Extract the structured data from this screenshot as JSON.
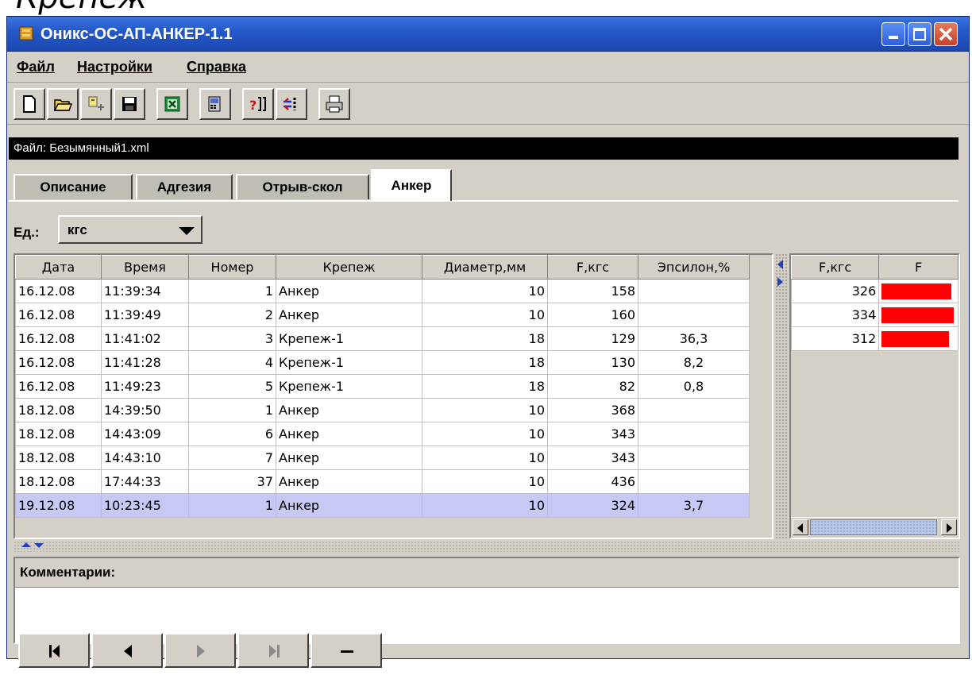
{
  "window": {
    "title": "Оникс-ОС-АП-АНКЕР-1.1",
    "titlebar_color": "#2559c9",
    "controls": [
      "minimize-icon",
      "maximize-icon",
      "close-icon"
    ]
  },
  "menu": {
    "items": [
      {
        "label": "Файл"
      },
      {
        "label": "Настройки"
      },
      {
        "label": "Справка"
      }
    ]
  },
  "toolbar": {
    "buttons": [
      "new-document-icon",
      "open-folder-icon",
      "import-icon",
      "save-icon",
      "excel-icon",
      "device-icon",
      "help-icon",
      "settings-icon",
      "print-icon"
    ]
  },
  "file": {
    "label": "Файл: Безымянный1.xml"
  },
  "tabs": [
    {
      "label": "Описание"
    },
    {
      "label": "Адгезия"
    },
    {
      "label": "Отрыв-скол"
    },
    {
      "label": "Анкер",
      "active": true
    }
  ],
  "units": {
    "label": "Ед.:",
    "value": "кгс"
  },
  "table": {
    "columns": [
      "Дата",
      "Время",
      "Номер",
      "Крепеж",
      "Диаметр,мм",
      "F,кгс",
      "Эпсилон,%"
    ],
    "rows": [
      [
        "16.12.08",
        "11:39:34",
        "1",
        "Анкер",
        "10",
        "158",
        ""
      ],
      [
        "16.12.08",
        "11:39:49",
        "2",
        "Анкер",
        "10",
        "160",
        ""
      ],
      [
        "16.12.08",
        "11:41:02",
        "3",
        "Крепеж-1",
        "18",
        "129",
        "36,3"
      ],
      [
        "16.12.08",
        "11:41:28",
        "4",
        "Крепеж-1",
        "18",
        "130",
        "8,2"
      ],
      [
        "16.12.08",
        "11:49:23",
        "5",
        "Крепеж-1",
        "18",
        "82",
        "0,8"
      ],
      [
        "18.12.08",
        "14:39:50",
        "1",
        "Анкер",
        "10",
        "368",
        ""
      ],
      [
        "18.12.08",
        "14:43:09",
        "6",
        "Анкер",
        "10",
        "343",
        ""
      ],
      [
        "18.12.08",
        "14:43:10",
        "7",
        "Анкер",
        "10",
        "343",
        ""
      ],
      [
        "18.12.08",
        "17:44:33",
        "37",
        "Анкер",
        "10",
        "436",
        ""
      ],
      [
        "19.12.08",
        "10:23:45",
        "1",
        "Анкер",
        "10",
        "324",
        "3,7"
      ]
    ],
    "selected_row": 9,
    "selected_color": "#c8c8f4"
  },
  "side_table": {
    "columns": [
      "F,кгс",
      "F"
    ],
    "rows": [
      {
        "value": "326",
        "bar_fraction": 0.95
      },
      {
        "value": "334",
        "bar_fraction": 0.98
      },
      {
        "value": "312",
        "bar_fraction": 0.91
      }
    ],
    "bar_color": "#ff0000"
  },
  "comments": {
    "label": "Комментарии:"
  },
  "navigation": {
    "buttons": [
      "first-record-icon",
      "previous-record-icon",
      "next-record-icon",
      "last-record-icon",
      "delete-record-icon"
    ]
  }
}
